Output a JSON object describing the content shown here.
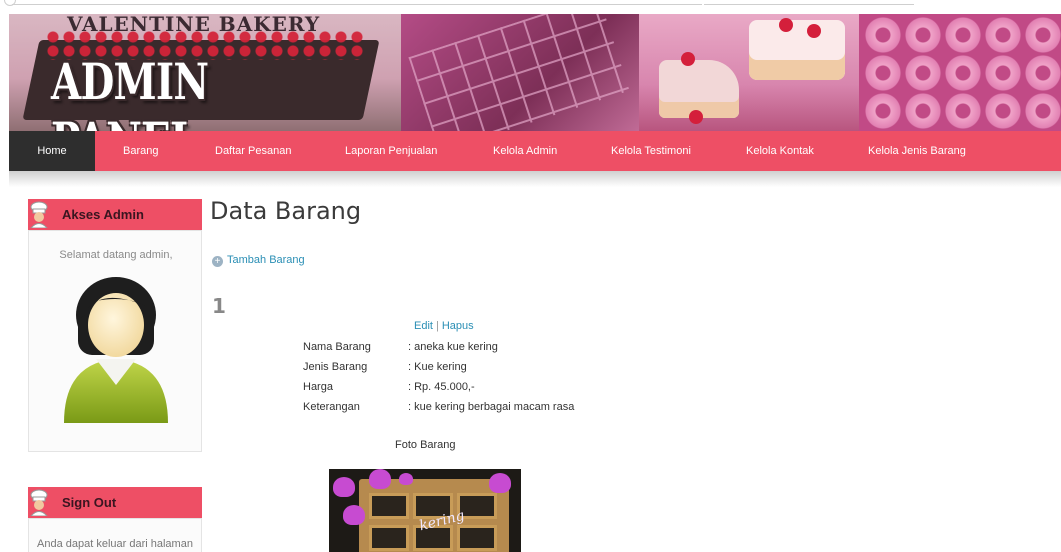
{
  "banner": {
    "brand_top": "VALENTINE BAKERY",
    "brand_main": "ADMIN PANEL"
  },
  "nav": {
    "items": [
      {
        "label": "Home",
        "active": true
      },
      {
        "label": "Barang"
      },
      {
        "label": "Daftar Pesanan"
      },
      {
        "label": "Laporan Penjualan"
      },
      {
        "label": "Kelola Admin"
      },
      {
        "label": "Kelola Testimoni"
      },
      {
        "label": "Kelola Kontak"
      },
      {
        "label": "Kelola Jenis Barang"
      }
    ],
    "accent": "#ee4f65",
    "active_bg": "#2e2e2e"
  },
  "sidebar": {
    "akses": {
      "title": "Akses Admin",
      "welcome": "Selamat datang admin,",
      "icon": "chef-icon",
      "avatar_icon": "user-avatar-icon"
    },
    "signout": {
      "title": "Sign Out",
      "text": "Anda dapat keluar dari halaman",
      "icon": "chef-icon"
    }
  },
  "main": {
    "title": "Data Barang",
    "add_link": "Tambah Barang",
    "item": {
      "number": "1",
      "edit": "Edit",
      "separator": "|",
      "delete": "Hapus",
      "fields": [
        {
          "label": "Nama Barang",
          "value": ": aneka kue kering"
        },
        {
          "label": "Jenis Barang",
          "value": ": Kue kering"
        },
        {
          "label": "Harga",
          "value": ": Rp. 45.000,-"
        },
        {
          "label": "Keterangan",
          "value": ": kue kering berbagai macam rasa"
        }
      ],
      "photo_label": "Foto Barang",
      "photo_caption": "kering"
    }
  }
}
